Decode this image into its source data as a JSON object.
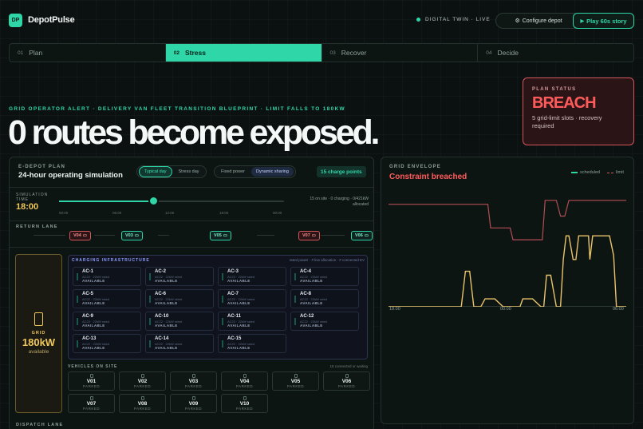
{
  "header": {
    "logo_text": "DP",
    "brand": "DepotPulse",
    "twin_status": "DIGITAL TWIN · LIVE",
    "configure_label": "Configure depot",
    "configure_icon": "gear-icon",
    "play_label": "Play 60s story",
    "play_icon": "play-icon"
  },
  "steps": [
    {
      "num": "01",
      "label": "Plan",
      "active": false
    },
    {
      "num": "02",
      "label": "Stress",
      "active": true
    },
    {
      "num": "03",
      "label": "Recover",
      "active": false
    },
    {
      "num": "04",
      "label": "Decide",
      "active": false
    }
  ],
  "hero": {
    "alert": "GRID OPERATOR ALERT · DELIVERY VAN FLEET TRANSITION BLUEPRINT · LIMIT FALLS TO 180KW",
    "headline": "0 routes become exposed."
  },
  "plan_status": {
    "label": "PLAN STATUS",
    "value": "BREACH",
    "sub": "5 grid-limit slots · recovery required"
  },
  "plan": {
    "label": "E-DEPOT PLAN",
    "title": "24-hour operating simulation",
    "scenario_options": [
      "Typical day",
      "Stress day"
    ],
    "scenario_selected": "Typical day",
    "power_options": [
      "Fixed power",
      "Dynamic sharing"
    ],
    "power_selected": "Dynamic sharing",
    "charge_points": "15 charge points",
    "sim_label_1": "SIMULATION",
    "sim_label_2": "TIME",
    "sim_time": "18:00",
    "sim_progress": 0.42,
    "ticks": [
      "00:00",
      "06:00",
      "12:00",
      "18:00",
      "00:00"
    ],
    "onsite": "15 on site · 0 charging · 0/421kW allocated",
    "return_lane": "RETURN LANE",
    "dispatch_lane": "DISPATCH LANE",
    "lane_vans": [
      {
        "id": "V04",
        "state": "alert"
      },
      {
        "id": "V03",
        "state": "ok"
      },
      {
        "id": "V05",
        "state": "ok"
      },
      {
        "id": "V07",
        "state": "alert"
      },
      {
        "id": "V06",
        "state": "ok"
      }
    ]
  },
  "grid_box": {
    "label": "GRID",
    "value": "180kW",
    "sub": "available"
  },
  "infra": {
    "title": "CHARGING INFRASTRUCTURE",
    "legend": "rated power · # live allocation · # connected EV",
    "chargers": [
      {
        "id": "AC-1",
        "spec": "AC22 · 22kW rated",
        "status": "AVAILABLE"
      },
      {
        "id": "AC-2",
        "spec": "AC22 · 22kW rated",
        "status": "AVAILABLE"
      },
      {
        "id": "AC-3",
        "spec": "AC22 · 22kW rated",
        "status": "AVAILABLE"
      },
      {
        "id": "AC-4",
        "spec": "AC22 · 22kW rated",
        "status": "AVAILABLE"
      },
      {
        "id": "AC-5",
        "spec": "AC22 · 22kW rated",
        "status": "AVAILABLE"
      },
      {
        "id": "AC-6",
        "spec": "AC22 · 22kW rated",
        "status": "AVAILABLE"
      },
      {
        "id": "AC-7",
        "spec": "AC22 · 22kW rated",
        "status": "AVAILABLE"
      },
      {
        "id": "AC-8",
        "spec": "AC22 · 22kW rated",
        "status": "AVAILABLE"
      },
      {
        "id": "AC-9",
        "spec": "AC22 · 22kW rated",
        "status": "AVAILABLE"
      },
      {
        "id": "AC-10",
        "spec": "AC22 · 22kW rated",
        "status": "AVAILABLE"
      },
      {
        "id": "AC-11",
        "spec": "AC22 · 22kW rated",
        "status": "AVAILABLE"
      },
      {
        "id": "AC-12",
        "spec": "AC22 · 22kW rated",
        "status": "AVAILABLE"
      },
      {
        "id": "AC-13",
        "spec": "AC22 · 22kW rated",
        "status": "AVAILABLE"
      },
      {
        "id": "AC-14",
        "spec": "AC22 · 22kW rated",
        "status": "AVAILABLE"
      },
      {
        "id": "AC-15",
        "spec": "AC22 · 22kW rated",
        "status": "AVAILABLE"
      }
    ]
  },
  "vehicles": {
    "title": "VEHICLES ON SITE",
    "note": "15 connected or waiting",
    "items": [
      {
        "id": "V01",
        "status": "PARKED"
      },
      {
        "id": "V02",
        "status": "PARKED"
      },
      {
        "id": "V03",
        "status": "PARKED"
      },
      {
        "id": "V04",
        "status": "PARKED"
      },
      {
        "id": "V05",
        "status": "PARKED"
      },
      {
        "id": "V06",
        "status": "PARKED"
      },
      {
        "id": "V07",
        "status": "PARKED"
      },
      {
        "id": "V08",
        "status": "PARKED"
      },
      {
        "id": "V09",
        "status": "PARKED"
      },
      {
        "id": "V10",
        "status": "PARKED"
      }
    ]
  },
  "envelope": {
    "label": "GRID ENVELOPE",
    "title": "Constraint breached",
    "legend_scheduled": "scheduled",
    "legend_limit": "limit",
    "colors": {
      "scheduled": "#e9c46a",
      "limit": "#b24d54",
      "alert": "#ff5b5b",
      "accent": "#2fd6a8"
    },
    "x_ticks": [
      "18:00",
      "00:00",
      "06:00"
    ]
  },
  "chart_data": {
    "type": "line",
    "title": "Constraint breached",
    "x": [
      0,
      0.5,
      1,
      1.5,
      2,
      2.5,
      3,
      3.5,
      4,
      4.5,
      5,
      5.5,
      6,
      6.5,
      7,
      7.5,
      8,
      8.5,
      9,
      9.5,
      10,
      10.5,
      11,
      11.5,
      12,
      12.5,
      13,
      13.5,
      14,
      14.5,
      15,
      15.5,
      16,
      16.5,
      17,
      17.5,
      18,
      18.5,
      19,
      19.5,
      20,
      20.5,
      21,
      21.5,
      22,
      22.5,
      23,
      23.5,
      24
    ],
    "x_ticks": [
      "18:00",
      "00:00",
      "06:00"
    ],
    "series": [
      {
        "name": "scheduled",
        "values": [
          0,
          0,
          0,
          0,
          0,
          0,
          0,
          0,
          0,
          0,
          0,
          0,
          0,
          0,
          0,
          0,
          0,
          0,
          0,
          0,
          0,
          0,
          0,
          0,
          30,
          30,
          0,
          0,
          0,
          0,
          0,
          0,
          0,
          0,
          0,
          0,
          0,
          0,
          0,
          0,
          0,
          0,
          0,
          0,
          0,
          0,
          0,
          0,
          0
        ]
      },
      {
        "name": "limit",
        "values": [
          320,
          320,
          320,
          320,
          320,
          320,
          320,
          320,
          320,
          320,
          320,
          320,
          320,
          320,
          320,
          320,
          320,
          320,
          320,
          320,
          320,
          320,
          320,
          320,
          320,
          320,
          320,
          320,
          320,
          320,
          320,
          320,
          320,
          320,
          320,
          320,
          320,
          320,
          320,
          320,
          320,
          320,
          320,
          320,
          320,
          320,
          320,
          320,
          320
        ]
      }
    ],
    "scheduled_points": [
      [
        0,
        0
      ],
      [
        5.2,
        0
      ],
      [
        5.5,
        90
      ],
      [
        5.8,
        90
      ],
      [
        6.1,
        0
      ],
      [
        6.6,
        0
      ],
      [
        6.9,
        20
      ],
      [
        7.6,
        20
      ],
      [
        8.2,
        0
      ],
      [
        9.4,
        0
      ],
      [
        9.6,
        20
      ],
      [
        10.3,
        20
      ],
      [
        10.9,
        0
      ],
      [
        11.1,
        0
      ],
      [
        11.3,
        80
      ],
      [
        11.6,
        80
      ],
      [
        12,
        0
      ],
      [
        12.3,
        0
      ],
      [
        12.5,
        120
      ],
      [
        12.7,
        180
      ],
      [
        12.9,
        180
      ],
      [
        13.2,
        120
      ],
      [
        13.4,
        120
      ],
      [
        13.6,
        180
      ],
      [
        14.3,
        180
      ],
      [
        14.4,
        120
      ],
      [
        14.6,
        180
      ],
      [
        15.8,
        180
      ],
      [
        16.1,
        130
      ],
      [
        16.3,
        0
      ],
      [
        17,
        0
      ]
    ],
    "limit_points": [
      [
        0,
        260
      ],
      [
        7.1,
        260
      ],
      [
        7.3,
        200
      ],
      [
        8.7,
        200
      ],
      [
        8.9,
        170
      ],
      [
        11,
        170
      ],
      [
        11.2,
        270
      ],
      [
        12,
        270
      ],
      [
        12.3,
        230
      ],
      [
        12.6,
        230
      ],
      [
        12.9,
        270
      ],
      [
        17,
        270
      ]
    ],
    "ylim": [
      0,
      300
    ],
    "grid": false,
    "legend": "top-right"
  }
}
